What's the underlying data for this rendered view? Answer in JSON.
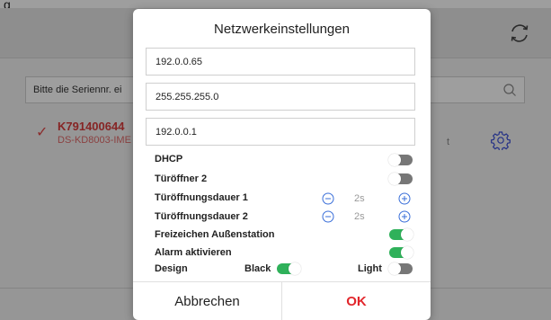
{
  "background": {
    "top_text": "g",
    "search_placeholder": "Bitte die Seriennr. ei",
    "device": {
      "id": "K791400644",
      "model": "DS-KD8003-IME",
      "status_fragment": "t"
    }
  },
  "dialog": {
    "title": "Netzwerkeinstellungen",
    "fields": [
      "192.0.0.65",
      "255.255.255.0",
      "192.0.0.1"
    ],
    "dhcp": {
      "label": "DHCP",
      "on": false
    },
    "door_opener_2": {
      "label": "Türöffner 2",
      "on": false
    },
    "door_duration_1": {
      "label": "Türöffnungsdauer 1",
      "value": "2s"
    },
    "door_duration_2": {
      "label": "Türöffnungsdauer 2",
      "value": "2s"
    },
    "free_tone": {
      "label": "Freizeichen Außenstation",
      "on": true
    },
    "alarm": {
      "label": "Alarm aktivieren",
      "on": true
    },
    "design": {
      "label": "Design",
      "black_label": "Black",
      "black_on": true,
      "light_label": "Light",
      "light_on": false
    },
    "cancel_label": "Abbrechen",
    "ok_label": "OK"
  },
  "colors": {
    "accent_red": "#e2262b",
    "toggle_on": "#2fb15a",
    "toggle_off": "#777777",
    "icon_blue": "#3a4fd9"
  }
}
